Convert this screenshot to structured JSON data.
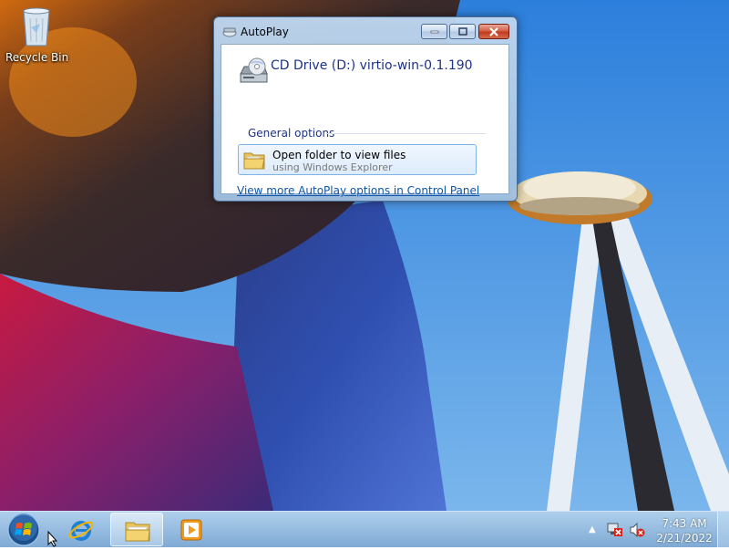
{
  "desktop": {
    "icons": [
      {
        "label": "Recycle Bin",
        "icon": "recycle-bin-icon"
      }
    ]
  },
  "autoplay": {
    "window_title": "AutoPlay",
    "drive_title": "CD Drive (D:) virtio-win-0.1.190",
    "group_label": "General options",
    "options": [
      {
        "title": "Open folder to view files",
        "subtitle": "using Windows Explorer",
        "icon": "folder-icon"
      }
    ],
    "more_link": "View more AutoPlay options in Control Panel"
  },
  "taskbar": {
    "pinned": [
      {
        "name": "internet-explorer",
        "icon": "ie-icon"
      },
      {
        "name": "windows-explorer",
        "icon": "folder-icon",
        "active": true
      },
      {
        "name": "media-player",
        "icon": "media-player-icon"
      }
    ],
    "clock": {
      "time": "7:43 AM",
      "date": "2/21/2022"
    }
  },
  "colors": {
    "link": "#0f55a8",
    "heading": "#1e3287",
    "option_border": "#7eb4ea",
    "close_button": "#c23c1f"
  }
}
